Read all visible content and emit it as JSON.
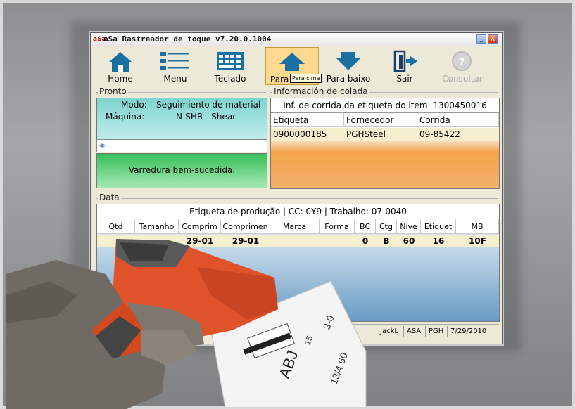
{
  "window": {
    "title": "aSa Rastreador de toque v7.20.0.1004",
    "app_icon": "aSa",
    "minimize_label": "_",
    "close_label": "X"
  },
  "toolbar": {
    "buttons": [
      {
        "label": "Home",
        "icon": "home-icon",
        "enabled": true
      },
      {
        "label": "Menu",
        "icon": "menu-list-icon",
        "enabled": true
      },
      {
        "label": "Teclado",
        "icon": "keyboard-icon",
        "enabled": true
      },
      {
        "label": "Para",
        "icon": "arrow-up-icon",
        "enabled": true,
        "active": true
      },
      {
        "label": "Para baixo",
        "icon": "arrow-down-icon",
        "enabled": true
      },
      {
        "label": "Sair",
        "icon": "exit-door-icon",
        "enabled": true
      },
      {
        "label": "Consultar",
        "icon": "question-icon",
        "enabled": false
      }
    ],
    "tooltip": "Para cima"
  },
  "pronto": {
    "group_label": "Pronto",
    "modo_label": "Modo:",
    "modo_value": "Seguimiento de material",
    "maquina_label": "Máquina:",
    "maquina_value": "N-SHR - Shear",
    "status_message": "Varredura bem-sucedida."
  },
  "colada": {
    "group_label": "Información de colada",
    "title": "Inf. de corrida da etiqueta do item: 1300450016",
    "columns": [
      "Etiqueta",
      "Fornecedor",
      "Corrida"
    ],
    "rows": [
      [
        "0900000185",
        "PGHSteel",
        "09-85422"
      ]
    ]
  },
  "data": {
    "group_label": "Data",
    "title": "Etiqueta de produção | CC: 0Y9  | Trabalho: 07-0040",
    "columns": [
      "Qtd",
      "Tamanho",
      "Comprim",
      "Comprimen",
      "Marca",
      "Forma",
      "BC",
      "Ctg",
      "Níve",
      "Etiquet",
      "MB"
    ],
    "rows": [
      [
        "",
        "",
        "29-01",
        "29-01",
        "",
        "",
        "0",
        "B",
        "60",
        "16",
        "10F"
      ]
    ]
  },
  "statusbar": {
    "user": "JackL",
    "company": "ASA",
    "site": "PGH",
    "date": "7/29/2010"
  },
  "label_paper": {
    "text_1": "3-0",
    "text_2": "ABJ",
    "text_3": "13/4 60",
    "text_4": "15"
  },
  "colors": {
    "pronto_teal": "#7ed4d1",
    "status_green": "#37c05a",
    "info_orange": "#f5a34b",
    "data_blue": "#6a9bc4",
    "scanner_orange": "#e0532a"
  }
}
